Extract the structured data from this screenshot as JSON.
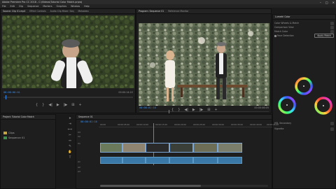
{
  "window": {
    "title": "Adobe Premiere Pro CC 2018 - C:\\Videos\\Tutorial Color Match.prproj",
    "minimize": "–",
    "maximize": "□",
    "close": "✕"
  },
  "menu": [
    "File",
    "Edit",
    "Clip",
    "Sequence",
    "Markers",
    "Graphics",
    "Window",
    "Help"
  ],
  "source_panel": {
    "tabs": [
      "Source: Clip 01.mp4",
      "Effect Controls",
      "Audio Clip Mixer: Seq",
      "Metadata"
    ],
    "timecode": "00:00:00:01",
    "duration": "00:00:14:22"
  },
  "program_panel": {
    "tabs": [
      "Program: Sequence 01",
      "Reference Monitor"
    ],
    "timecode": "00:00:01:16",
    "duration": "00:00:46:05"
  },
  "transport": {
    "mark_in": "{",
    "mark_out": "}",
    "step_back": "◀|",
    "play": "▶",
    "step_fwd": "|▶",
    "insert": "⊞",
    "export": "📷",
    "plus": "+"
  },
  "project_panel": {
    "tabs": [
      "Project: Tutorial Color Match",
      "Media Browser"
    ],
    "items": [
      "Clips",
      "Sequence 01"
    ]
  },
  "timeline": {
    "tabs": [
      "Sequence 01"
    ],
    "timecode": "00:00:01:16",
    "video_tracks": [
      "V3",
      "V2",
      "V1"
    ],
    "audio_tracks": [
      "A1",
      "A2",
      "A3"
    ],
    "ruler_marks": [
      "00:00",
      "00:00:05:00",
      "00:00:10:00",
      "00:00:15:00",
      "00:00:20:00",
      "00:00:25:00",
      "00:00:30:00",
      "00:00:35:00",
      "00:00:40:00",
      "00:00:45:00"
    ]
  },
  "lumetri": {
    "header": "Lumetri Color",
    "section": "Color Wheels & Match",
    "rows": [
      "Comparison View",
      "Match Color",
      "Face Detection",
      "Apply Match",
      "HSL Secondary",
      "Vignette"
    ],
    "button": "Apply Match",
    "checkbox_label": "Face Detection",
    "wheel_labels": [
      "Shadows",
      "Midtones",
      "Highlights"
    ],
    "wheel_colors": [
      "#ff3b3b",
      "#ffd33b",
      "#3bff6a",
      "#3bd8ff",
      "#3b5bff",
      "#e03bff"
    ]
  }
}
